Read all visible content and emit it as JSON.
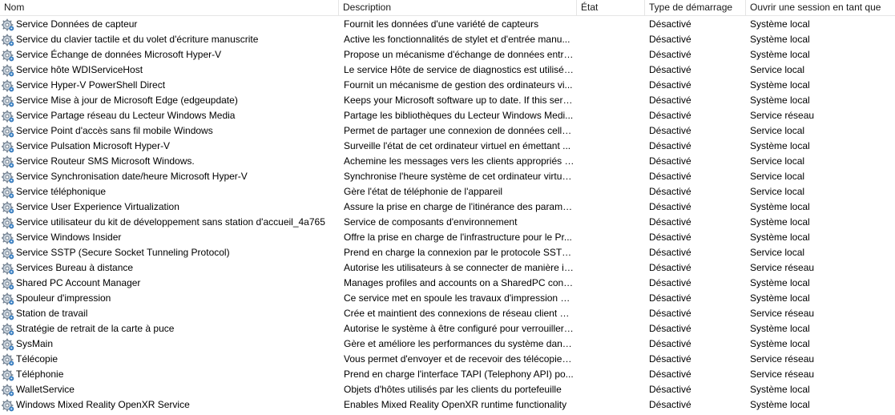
{
  "columns": {
    "name": "Nom",
    "description": "Description",
    "state": "État",
    "startup_type": "Type de démarrage",
    "logon_as": "Ouvrir une session en tant que"
  },
  "row_icon": "gear-icon",
  "colors": {
    "gear_dark": "#6b7a8a",
    "gear_light": "#c9d3dd",
    "gear_accent": "#4a8fd0"
  },
  "rows": [
    {
      "name": "Service Données de capteur",
      "description": "Fournit les données d'une variété de capteurs",
      "state": "",
      "startup_type": "Désactivé",
      "logon_as": "Système local"
    },
    {
      "name": "Service du clavier tactile et du volet d'écriture manuscrite",
      "description": "Active les fonctionnalités de stylet et d'entrée manu...",
      "state": "",
      "startup_type": "Désactivé",
      "logon_as": "Système local"
    },
    {
      "name": "Service Échange de données Microsoft Hyper-V",
      "description": "Propose un mécanisme d'échange de données entre...",
      "state": "",
      "startup_type": "Désactivé",
      "logon_as": "Système local"
    },
    {
      "name": "Service hôte WDIServiceHost",
      "description": "Le service Hôte de service de diagnostics est utilisé p...",
      "state": "",
      "startup_type": "Désactivé",
      "logon_as": "Service local"
    },
    {
      "name": "Service Hyper-V PowerShell Direct",
      "description": "Fournit un mécanisme de gestion des ordinateurs vi...",
      "state": "",
      "startup_type": "Désactivé",
      "logon_as": "Système local"
    },
    {
      "name": "Service Mise à jour de Microsoft Edge (edgeupdate)",
      "description": "Keeps your Microsoft software up to date. If this serv...",
      "state": "",
      "startup_type": "Désactivé",
      "logon_as": "Système local"
    },
    {
      "name": "Service Partage réseau du Lecteur Windows Media",
      "description": "Partage les bibliothèques du Lecteur Windows Medi...",
      "state": "",
      "startup_type": "Désactivé",
      "logon_as": "Service réseau"
    },
    {
      "name": "Service Point d'accès sans fil mobile Windows",
      "description": "Permet de partager une connexion de données cellu...",
      "state": "",
      "startup_type": "Désactivé",
      "logon_as": "Service local"
    },
    {
      "name": "Service Pulsation Microsoft Hyper-V",
      "description": "Surveille l'état de cet ordinateur virtuel en émettant ...",
      "state": "",
      "startup_type": "Désactivé",
      "logon_as": "Système local"
    },
    {
      "name": "Service Routeur SMS Microsoft Windows.",
      "description": "Achemine les messages vers les clients appropriés s...",
      "state": "",
      "startup_type": "Désactivé",
      "logon_as": "Service local"
    },
    {
      "name": "Service Synchronisation date/heure Microsoft Hyper-V",
      "description": "Synchronise l'heure système de cet ordinateur virtue...",
      "state": "",
      "startup_type": "Désactivé",
      "logon_as": "Service local"
    },
    {
      "name": "Service téléphonique",
      "description": "Gère l'état de téléphonie de l'appareil",
      "state": "",
      "startup_type": "Désactivé",
      "logon_as": "Service local"
    },
    {
      "name": "Service User Experience Virtualization",
      "description": "Assure la prise en charge de l'itinérance des paramèt...",
      "state": "",
      "startup_type": "Désactivé",
      "logon_as": "Système local"
    },
    {
      "name": "Service utilisateur du kit de développement sans station d'accueil_4a765",
      "description": "Service de composants d'environnement",
      "state": "",
      "startup_type": "Désactivé",
      "logon_as": "Système local"
    },
    {
      "name": "Service Windows Insider",
      "description": "Offre la prise en charge de l'infrastructure pour le Pr...",
      "state": "",
      "startup_type": "Désactivé",
      "logon_as": "Système local"
    },
    {
      "name": "Service SSTP (Secure Socket Tunneling Protocol)",
      "description": "Prend en charge la connexion par le protocole SSTP ...",
      "state": "",
      "startup_type": "Désactivé",
      "logon_as": "Service local"
    },
    {
      "name": "Services Bureau à distance",
      "description": "Autorise les utilisateurs à se connecter de manière in...",
      "state": "",
      "startup_type": "Désactivé",
      "logon_as": "Service réseau"
    },
    {
      "name": "Shared PC Account Manager",
      "description": "Manages profiles and accounts on a SharedPC confi...",
      "state": "",
      "startup_type": "Désactivé",
      "logon_as": "Système local"
    },
    {
      "name": "Spouleur d'impression",
      "description": "Ce service met en spoule les travaux d'impression et...",
      "state": "",
      "startup_type": "Désactivé",
      "logon_as": "Système local"
    },
    {
      "name": "Station de travail",
      "description": "Crée et maintient des connexions de réseau client à ...",
      "state": "",
      "startup_type": "Désactivé",
      "logon_as": "Service réseau"
    },
    {
      "name": "Stratégie de retrait de la carte à puce",
      "description": "Autorise le système à être configuré pour verrouiller ...",
      "state": "",
      "startup_type": "Désactivé",
      "logon_as": "Système local"
    },
    {
      "name": "SysMain",
      "description": "Gère et améliore les performances du système dans l...",
      "state": "",
      "startup_type": "Désactivé",
      "logon_as": "Système local"
    },
    {
      "name": "Télécopie",
      "description": "Vous permet d'envoyer et de recevoir des télécopies,...",
      "state": "",
      "startup_type": "Désactivé",
      "logon_as": "Service réseau"
    },
    {
      "name": "Téléphonie",
      "description": "Prend en charge l'interface TAPI (Telephony API) po...",
      "state": "",
      "startup_type": "Désactivé",
      "logon_as": "Service réseau"
    },
    {
      "name": "WalletService",
      "description": "Objets d'hôtes utilisés par les clients du portefeuille",
      "state": "",
      "startup_type": "Désactivé",
      "logon_as": "Système local"
    },
    {
      "name": "Windows Mixed Reality OpenXR Service",
      "description": "Enables Mixed Reality OpenXR runtime functionality",
      "state": "",
      "startup_type": "Désactivé",
      "logon_as": "Système local"
    }
  ]
}
